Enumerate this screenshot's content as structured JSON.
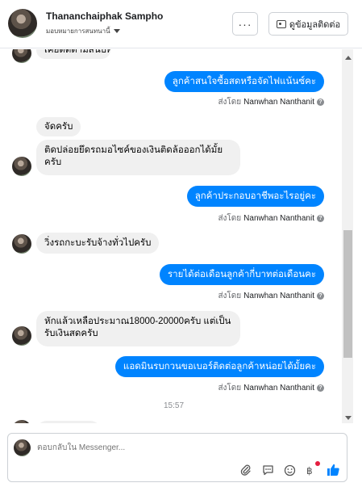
{
  "header": {
    "name": "Thananchaiphak Sampho",
    "assign_label": "มอบหมายการสนทนานี้",
    "more_label": "···",
    "contact_label": "ดูข้อมูลติดต่อ"
  },
  "messages": {
    "m0": "เคยติดตามสนับพี่คาปสุย",
    "m1": "ลูกค้าสนใจซื้อสดหรือจัดไฟแน้นซ์คะ",
    "m2": "จัดครับ",
    "m3_line1": "ติดปล่อยยึดรถมอไซค์ของเงินติดล้อออกได้มั้ย",
    "m3_line2": "ครับ",
    "m4": "ลูกค้าประกอบอาชีพอะไรอยู่คะ",
    "m5": "วิ่งรถกะบะรับจ้างทั่วไปครับ",
    "m6": "รายได้ต่อเดือนลูกค้ากี่บาทต่อเดือนคะ",
    "m7_line1": "หักแล้วเหลือประมาณ18000-20000ครับ แต่เป็น",
    "m7_line2": "รับเงินสดครับ",
    "m8": "แอดมินรบกวนขอเบอร์ติดต่อลูกค้าหน่อยได้มั้ยคะ"
  },
  "sent_by": {
    "prefix": "ส่งโดย",
    "name": "Nanwhan Nanthanit",
    "help": "?"
  },
  "timestamp": "15:57",
  "composer": {
    "placeholder": "ตอบกลับใน Messenger..."
  },
  "colors": {
    "outgoing_bubble": "#0084ff",
    "incoming_bubble": "#f0f0f0",
    "like_icon": "#0084ff",
    "notification_dot": "#e41e3f"
  },
  "icons": [
    "attachment-icon",
    "saved-replies-icon",
    "emoji-icon",
    "payment-icon",
    "like-icon"
  ]
}
